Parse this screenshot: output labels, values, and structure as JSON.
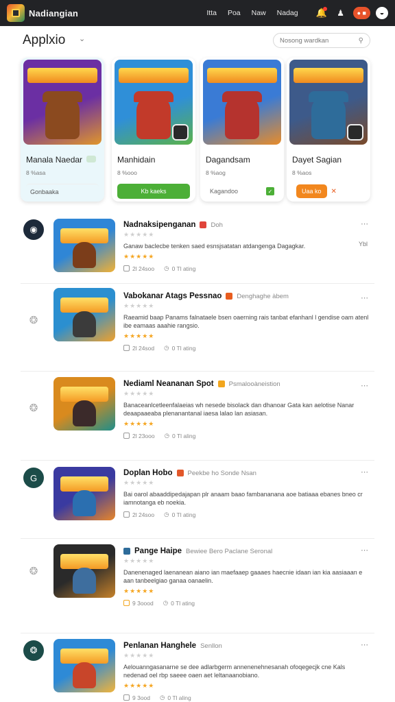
{
  "app": {
    "brand": "Nadiangian",
    "nav": [
      "Itta",
      "Poa",
      "Naw",
      "Nadag"
    ],
    "pill": "● ■",
    "avatar": "◒"
  },
  "header": {
    "title": "Applxio",
    "search_placeholder": "Nosong wardkan"
  },
  "featured": [
    {
      "title": "Manala Naedar",
      "sub": "8  %asa",
      "cta": "Gonbaaka",
      "cta_style": "plain",
      "colors": [
        "#6b2fa3",
        "#e0962b",
        "#8b4a1f"
      ]
    },
    {
      "title": "Manhidain",
      "sub": "8  %ooo",
      "cta": "Kb kaeks",
      "cta_style": "green",
      "colors": [
        "#2f8fd8",
        "#5bb24a",
        "#c23a2a"
      ]
    },
    {
      "title": "Dagandsam",
      "sub": "8  %aog",
      "cta": "Kagandoo",
      "cta_style": "tag",
      "colors": [
        "#3a7bd5",
        "#e88c2a",
        "#b5332e"
      ]
    },
    {
      "title": "Dayet Sagian",
      "sub": "8  %aos",
      "cta": "Uaa ko",
      "cta_style": "orange",
      "colors": [
        "#3d5a8a",
        "#7a4a2a",
        "#2e6c9a"
      ]
    }
  ],
  "list": [
    {
      "lead": "◉",
      "lead_style": "dark",
      "name": "Nadnaksipenganan",
      "meta": "Doh",
      "desc": "Ganaw baclecbe tenken saed esnsjsatatan atdangenga Dagagkar.",
      "side": "Ybl",
      "stats_a": "2l 24soo",
      "stats_b": "0  Tl ating",
      "colors": [
        "#2f86d6",
        "#f2b134",
        "#7b3d1a"
      ]
    },
    {
      "lead": "❂",
      "lead_style": "ghost",
      "name": "Vabokanar Atags Pessnao",
      "meta": "Denghaghe àbem",
      "desc": "Raeamid baap Panams falnataele bsen oaerning rais tanbat efanhanl l gendise oam atenl ibe eamaas aaahie rangsio.",
      "side": "",
      "stats_a": "2l 24sod",
      "stats_b": "0  Tl ating",
      "colors": [
        "#2b8fd0",
        "#f0a12c",
        "#3b3b3b"
      ]
    },
    {
      "lead": "❂",
      "lead_style": "ghost",
      "name": "Nediaml Neananan Spot",
      "meta": "Psmalooàneistion",
      "desc": "Banaceanlcetleenfalaeias wh nesede bisolack dan dhanoar Gata kan aelotise Nanar deaapaaeaba plenanantanal iaesa lalao lan asiasan.",
      "side": "",
      "stats_a": "2l 23ooo",
      "stats_b": "0  Tl aling",
      "colors": [
        "#d98a1e",
        "#1f8e8a",
        "#3b2a2a"
      ]
    },
    {
      "lead": "G",
      "lead_style": "teal",
      "name": "Doplan Hobo",
      "meta": "Peekbe ho Sonde Nsan",
      "desc": "Bai oarol abaaddipedajapan plr anaam baao fambananana aoe batiaaa ebanes bneo cr iamnotanga eb noekia.",
      "side": "",
      "stats_a": "2l 24soo",
      "stats_b": "0  Tl ating",
      "colors": [
        "#3a3aa0",
        "#e8862a",
        "#2b6fb0"
      ]
    },
    {
      "lead": "❂",
      "lead_style": "ghost",
      "name": "Pange Haipe",
      "meta": "Bewiee Bero     Paclane Seronal",
      "desc": "Danenenaged laenanean aiano ian maefaaep gaaaes haecnie idaan ian kia aasiaaan e aan tanbeelgiao ganaa oanaelin.",
      "side": "",
      "stats_a": "9 3oood",
      "stats_b": "0  Tl ating",
      "colors": [
        "#2a2a2a",
        "#c7822a",
        "#3e6e9e"
      ]
    },
    {
      "lead": "❂",
      "lead_style": "teal",
      "name": "Penlanan Hanghele",
      "meta": "Senllon",
      "desc": "Aelouanngasanarne se dee adlarbgerm annenenehnesanah ofoqegecjk cne Kals nedenad oel rbp saeee oaen aet leltanaanobiano.",
      "side": "",
      "stats_a": "9 3ood",
      "stats_b": "0  Tl aling",
      "colors": [
        "#2e8ad6",
        "#f2b43a",
        "#c8452a"
      ]
    }
  ],
  "stars": {
    "grey": "★★★★★",
    "gold": "★★★★★"
  }
}
